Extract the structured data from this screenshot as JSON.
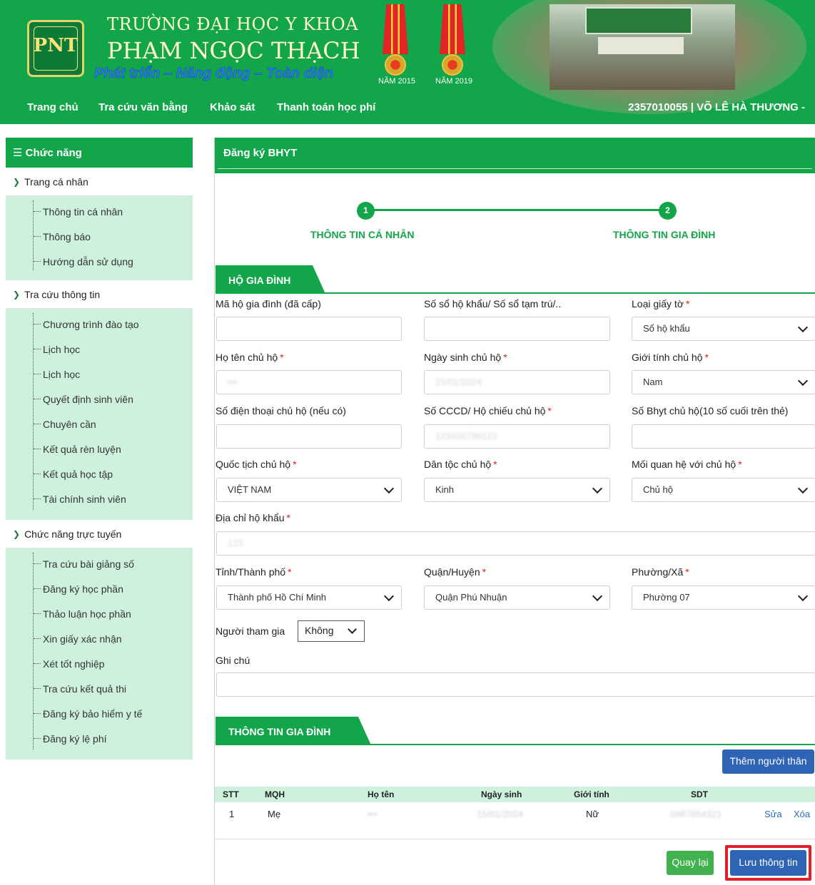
{
  "header": {
    "logo_text": "PNT",
    "school_line1": "TRƯỜNG ĐẠI HỌC Y KHOA",
    "school_line2": "PHẠM NGỌC THẠCH",
    "slogan": "Phát triển – Năng động – Toàn diện",
    "medals": [
      {
        "caption": "NĂM 2015"
      },
      {
        "caption": "NĂM 2019"
      }
    ],
    "nav": [
      "Trang chủ",
      "Tra cứu văn bằng",
      "Khảo sát",
      "Thanh toán học phí"
    ],
    "user": "2357010055 | VÕ LÊ HÀ THƯƠNG -"
  },
  "sidebar": {
    "title": "☰ Chức năng",
    "sections": [
      {
        "label": "Trang cá nhân",
        "items": [
          "Thông tin cá nhân",
          "Thông báo",
          "Hướng dẫn sử dụng"
        ]
      },
      {
        "label": "Tra cứu thông tin",
        "items": [
          "Chương trình đào tạo",
          "Lịch học",
          "Lịch học",
          "Quyết định sinh viên",
          "Chuyên cần",
          "Kết quả rèn luyện",
          "Kết quả học tập",
          "Tài chính sinh viên"
        ]
      },
      {
        "label": "Chức năng trực tuyến",
        "items": [
          "Tra cứu bài giảng số",
          "Đăng ký học phần",
          "Thảo luận học phần",
          "Xin giấy xác nhận",
          "Xét tốt nghiệp",
          "Tra cứu kết quả thi",
          "Đăng ký bảo hiểm y tế",
          "Đăng ký lệ phí"
        ]
      }
    ]
  },
  "main": {
    "title": "Đăng ký BHYT",
    "steps": [
      {
        "num": "1",
        "label": "THÔNG TIN CÁ NHÂN"
      },
      {
        "num": "2",
        "label": "THÔNG TIN GIA ĐÌNH"
      }
    ],
    "household_tab": "HỘ GIA ĐÌNH",
    "form": {
      "ma_ho": {
        "label": "Mã hộ gia đình (đã cấp)",
        "value": ""
      },
      "so_ho_khau": {
        "label": "Số sổ hộ khẩu/ Số sổ tạm trú/..",
        "value": ""
      },
      "loai_giay_to": {
        "label": "Loại giấy tờ",
        "value": "Sổ hộ khẩu"
      },
      "ho_ten": {
        "label": "Họ tên chủ hộ",
        "value": "•••"
      },
      "ngay_sinh": {
        "label": "Ngày sinh chủ hộ",
        "value": "15/01/2024"
      },
      "gioi_tinh": {
        "label": "Giới tính chủ hộ",
        "value": "Nam"
      },
      "sdt": {
        "label": "Số điện thoại chủ hộ (nếu có)",
        "value": ""
      },
      "cccd": {
        "label": "Số CCCD/ Hộ chiếu chủ hộ",
        "value": "123456789123"
      },
      "bhyt": {
        "label": "Số Bhyt chủ hộ(10 số cuối trên thẻ)",
        "value": ""
      },
      "quoc_tich": {
        "label": "Quốc tịch chủ hộ",
        "value": "VIỆT NAM"
      },
      "dan_toc": {
        "label": "Dân tộc chủ hộ",
        "value": "Kinh"
      },
      "quan_he": {
        "label": "Mối quan hệ với chủ hộ",
        "value": "Chủ hộ"
      },
      "dia_chi": {
        "label": "Địa chỉ hộ khẩu",
        "value": "123"
      },
      "tinh": {
        "label": "Tỉnh/Thành phố",
        "value": "Thành phố Hồ Chí Minh"
      },
      "quan": {
        "label": "Quận/Huyện",
        "value": "Quận Phú Nhuận"
      },
      "phuong": {
        "label": "Phường/Xã",
        "value": "Phường 07"
      },
      "nguoi_tham_gia": {
        "label": "Người tham gia",
        "value": "Không"
      },
      "ghi_chu": {
        "label": "Ghi chú",
        "value": ""
      }
    },
    "family_tab": "THÔNG TIN GIA ĐÌNH",
    "add_button": "Thêm người thân",
    "table": {
      "headers": [
        "STT",
        "MQH",
        "Họ tên",
        "Ngày sinh",
        "Giới tính",
        "SDT"
      ],
      "rows": [
        {
          "stt": "1",
          "mqh": "Mẹ",
          "ho_ten": "•••",
          "ngay_sinh": "15/01/2024",
          "gioi_tinh": "Nữ",
          "sdt": "0987654321",
          "edit": "Sửa",
          "delete": "Xóa"
        }
      ]
    },
    "back_button": "Quay lại",
    "save_button": "Lưu thông tin"
  }
}
